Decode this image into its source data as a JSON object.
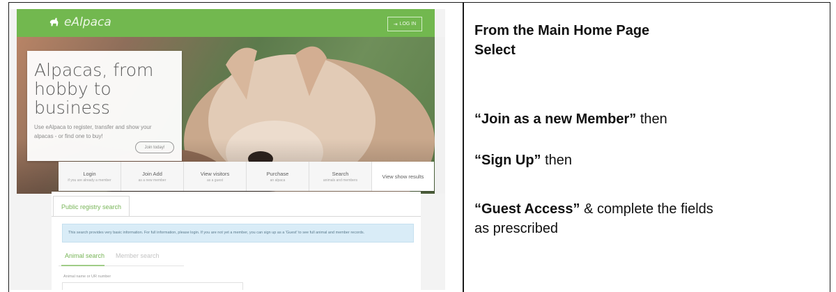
{
  "screenshot": {
    "app_name": "eAlpaca",
    "login_label": "LOG IN",
    "hero": {
      "title_line1": "Alpacas, from",
      "title_line2": "hobby to business",
      "subtitle": "Use eAlpaca to register, transfer and show your alpacas - or find one to buy!",
      "button_label": "Join today!"
    },
    "actions": [
      {
        "title": "Login",
        "sub": "if you are already a member"
      },
      {
        "title": "Join Add",
        "sub": "as a new member"
      },
      {
        "title": "View visitors",
        "sub": "as a guest"
      },
      {
        "title": "Purchase",
        "sub": "an alpaca"
      },
      {
        "title": "Search",
        "sub": "animals and members"
      },
      {
        "title": "View show results",
        "sub": ""
      }
    ],
    "registry_tab": "Public registry search",
    "info_text": "This search provides very basic information. For full information, please login. If you are not yet a member, you can sign up as a 'Guest' to see full animal and member records.",
    "subtabs": [
      "Animal search",
      "Member search"
    ],
    "field_label": "Animal name or UR number"
  },
  "instructions": {
    "line1": "From the Main Home Page",
    "line2": "Select",
    "step1_bold": "“Join as a new Member”",
    "step1_rest": " then",
    "step2_bold": "“Sign Up”",
    "step2_rest": " then",
    "step3_bold": "“Guest Access”",
    "step3_rest": " & complete the fields",
    "step3_line2": "as  prescribed"
  },
  "colors": {
    "brand_green": "#72b84f",
    "info_blue": "#d9ecf7"
  }
}
